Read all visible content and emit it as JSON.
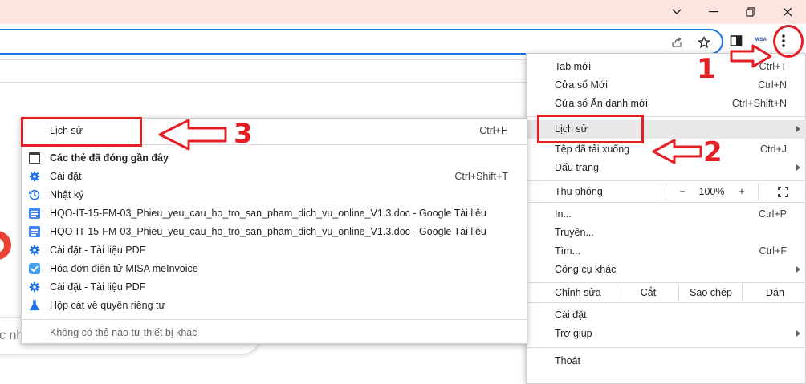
{
  "window_controls": {
    "minimize": "minimize-icon",
    "restore": "restore-icon",
    "close": "close-icon"
  },
  "toolbar": {
    "extension_label": "MISA"
  },
  "search": {
    "placeholder_fragment": "c nh"
  },
  "menu": {
    "items": [
      {
        "label": "Tab mới",
        "shortcut": "Ctrl+T"
      },
      {
        "label": "Cửa sổ Mới",
        "shortcut": "Ctrl+N"
      },
      {
        "label": "Cửa sổ Ẩn danh mới",
        "shortcut": "Ctrl+Shift+N"
      },
      {
        "label": "Lịch sử",
        "shortcut": ""
      },
      {
        "label": "Tệp đã tải xuống",
        "shortcut": "Ctrl+J"
      },
      {
        "label": "Dấu trang",
        "shortcut": ""
      },
      {
        "label": "In...",
        "shortcut": "Ctrl+P"
      },
      {
        "label": "Truyền...",
        "shortcut": ""
      },
      {
        "label": "Tìm...",
        "shortcut": "Ctrl+F"
      },
      {
        "label": "Công cụ khác",
        "shortcut": ""
      },
      {
        "label": "Cài đặt",
        "shortcut": ""
      },
      {
        "label": "Trợ giúp",
        "shortcut": ""
      },
      {
        "label": "Thoát",
        "shortcut": ""
      }
    ],
    "zoom": {
      "label": "Thu phóng",
      "minus": "−",
      "value": "100%",
      "plus": "+"
    },
    "edit": {
      "label": "Chỉnh sửa",
      "cut": "Cắt",
      "copy": "Sao chép",
      "paste": "Dán"
    }
  },
  "history_submenu": {
    "header": {
      "label": "Lịch sử",
      "shortcut": "Ctrl+H"
    },
    "recent_tabs": "Các thẻ đã đóng gần đây",
    "items": [
      {
        "icon": "gear-icon",
        "label": "Cài đặt",
        "shortcut": "Ctrl+Shift+T"
      },
      {
        "icon": "history-icon",
        "label": "Nhật ký",
        "shortcut": ""
      },
      {
        "icon": "google-docs-icon",
        "label": "HQO-IT-15-FM-03_Phieu_yeu_cau_ho_tro_san_pham_dich_vu_online_V1.3.doc - Google Tài liệu",
        "shortcut": ""
      },
      {
        "icon": "google-docs-icon",
        "label": "HQO-IT-15-FM-03_Phieu_yeu_cau_ho_tro_san_pham_dich_vu_online_V1.3.doc - Google Tài liệu",
        "shortcut": ""
      },
      {
        "icon": "gear-icon",
        "label": "Cài đặt - Tài liệu PDF",
        "shortcut": ""
      },
      {
        "icon": "misa-icon",
        "label": "Hóa đơn điện tử MISA meInvoice",
        "shortcut": ""
      },
      {
        "icon": "gear-icon",
        "label": "Cài đặt - Tài liệu PDF",
        "shortcut": ""
      },
      {
        "icon": "flask-icon",
        "label": "Hộp cát về quyền riêng tư",
        "shortcut": ""
      }
    ],
    "other_devices": "Không có thẻ nào từ thiết bị khác"
  },
  "annotations": {
    "step1": "1",
    "step2": "2",
    "step3": "3",
    "color": "#e31e25"
  }
}
